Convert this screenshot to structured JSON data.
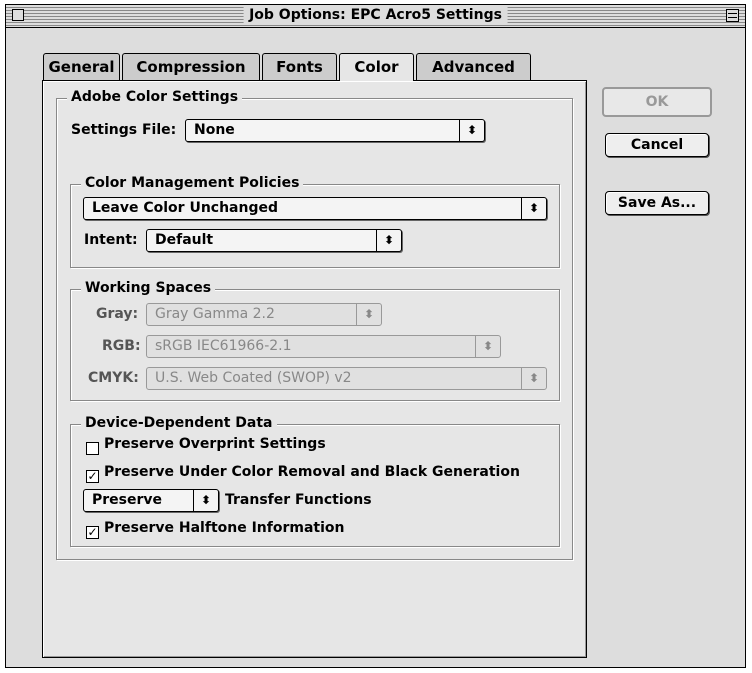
{
  "window": {
    "title": "Job Options: EPC Acro5 Settings"
  },
  "tabs": [
    {
      "label": "General"
    },
    {
      "label": "Compression"
    },
    {
      "label": "Fonts"
    },
    {
      "label": "Color"
    },
    {
      "label": "Advanced"
    }
  ],
  "active_tab": "Color",
  "adobe_color": {
    "title": "Adobe Color Settings",
    "settings_file_label": "Settings File:",
    "settings_file_value": "None"
  },
  "policies": {
    "title": "Color Management Policies",
    "policy_value": "Leave Color Unchanged",
    "intent_label": "Intent:",
    "intent_value": "Default"
  },
  "working_spaces": {
    "title": "Working Spaces",
    "gray_label": "Gray:",
    "gray_value": "Gray Gamma 2.2",
    "rgb_label": "RGB:",
    "rgb_value": "sRGB IEC61966-2.1",
    "cmyk_label": "CMYK:",
    "cmyk_value": "U.S. Web Coated (SWOP) v2"
  },
  "device": {
    "title": "Device-Dependent Data",
    "overprint_label": "Preserve Overprint Settings",
    "overprint_checked": false,
    "ucr_label": "Preserve Under Color Removal and Black Generation",
    "ucr_checked": true,
    "transfer_popup_value": "Preserve",
    "transfer_label": "Transfer Functions",
    "halftone_label": "Preserve Halftone Information",
    "halftone_checked": true
  },
  "buttons": {
    "ok": "OK",
    "cancel": "Cancel",
    "save_as": "Save As..."
  },
  "glyphs": {
    "popup_arrows": "⬍",
    "check_mark": "✓"
  }
}
